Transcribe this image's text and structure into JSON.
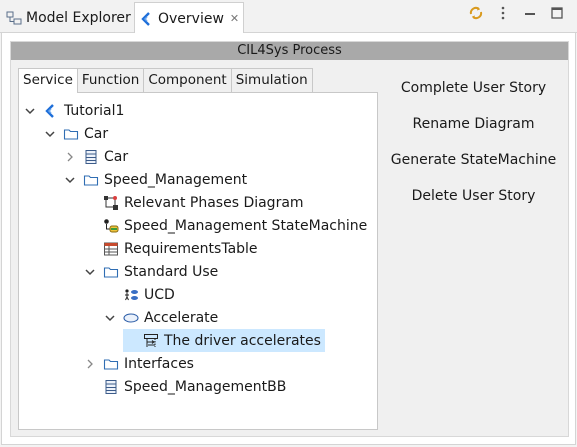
{
  "tabs": {
    "model_explorer": "Model Explorer",
    "overview": "Overview"
  },
  "header": {
    "title": "CIL4Sys Process"
  },
  "subtabs": [
    "Service",
    "Function",
    "Component",
    "Simulation"
  ],
  "tree": [
    {
      "label": "Tutorial1",
      "icon": "project-icon",
      "expander": "expanded"
    },
    {
      "label": "Car",
      "icon": "folder-icon",
      "expander": "expanded"
    },
    {
      "label": "Car",
      "icon": "block-icon",
      "expander": "collapsed"
    },
    {
      "label": "Speed_Management",
      "icon": "folder-icon",
      "expander": "expanded"
    },
    {
      "label": "Relevant Phases Diagram",
      "icon": "phases-diagram-icon",
      "expander": "none"
    },
    {
      "label": "Speed_Management StateMachine",
      "icon": "statemachine-icon",
      "expander": "none"
    },
    {
      "label": "RequirementsTable",
      "icon": "table-icon",
      "expander": "none"
    },
    {
      "label": "Standard Use",
      "icon": "folder-icon",
      "expander": "expanded"
    },
    {
      "label": "UCD",
      "icon": "usecase-diagram-icon",
      "expander": "none"
    },
    {
      "label": "Accelerate",
      "icon": "usecase-icon",
      "expander": "expanded"
    },
    {
      "label": "The driver accelerates",
      "icon": "interaction-icon",
      "expander": "none",
      "selected": true
    },
    {
      "label": "Interfaces",
      "icon": "folder-icon",
      "expander": "collapsed"
    },
    {
      "label": "Speed_ManagementBB",
      "icon": "block-icon",
      "expander": "none"
    }
  ],
  "actions": [
    "Complete User Story",
    "Rename Diagram",
    "Generate StateMachine",
    "Delete User Story"
  ],
  "colors": {
    "selection": "#cce8ff",
    "header": "#a9a9a9",
    "accent": "#1e6fd9"
  }
}
